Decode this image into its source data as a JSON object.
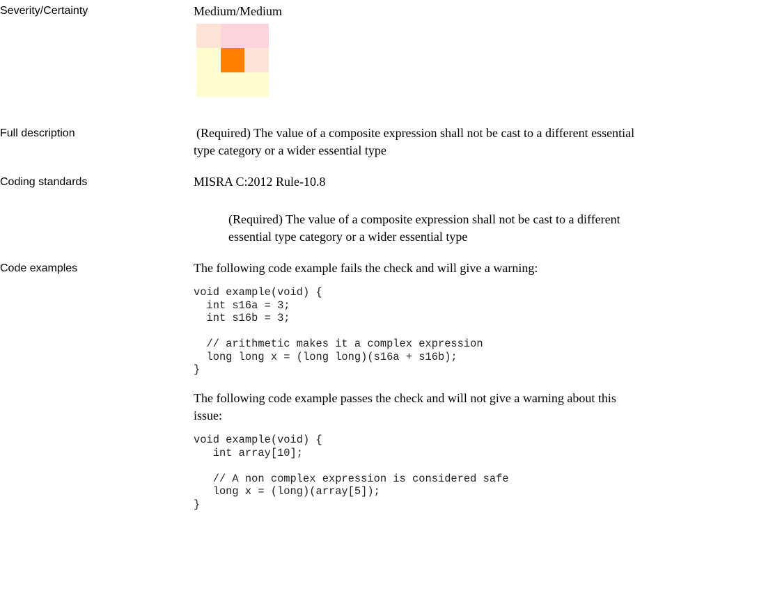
{
  "severity": {
    "label": "Severity/Certainty",
    "value": "Medium/Medium",
    "matrix_colors": [
      [
        "#fde2d6",
        "#fdd4dc",
        "#fdd4dc"
      ],
      [
        "#fffdd0",
        "#ff7f00",
        "#fde2d6"
      ],
      [
        "#fffdd0",
        "#fffdd0",
        "#fffdd0"
      ]
    ]
  },
  "full_description": {
    "label": "Full description",
    "text_line1": "(Required) The value of a composite expression shall not be cast to a different essential",
    "text_line2": "type category or a wider essential type"
  },
  "coding_standards": {
    "label": "Coding standards",
    "standard": "MISRA C:2012 Rule-10.8",
    "detail_line1": "(Required) The value of a composite expression shall not be cast to a different",
    "detail_line2": "essential type category or a wider essential type"
  },
  "code_examples": {
    "label": "Code examples",
    "fail_intro": "The following code example fails the check and will give a warning:",
    "fail_code": "void example(void) {\n  int s16a = 3;\n  int s16b = 3;\n\n  // arithmetic makes it a complex expression\n  long long x = (long long)(s16a + s16b);\n}",
    "pass_intro_line1": "The following code example passes the check and will not give a warning about this",
    "pass_intro_line2": "issue:",
    "pass_code": "void example(void) {\n   int array[10];\n\n   // A non complex expression is considered safe\n   long x = (long)(array[5]);\n}"
  }
}
